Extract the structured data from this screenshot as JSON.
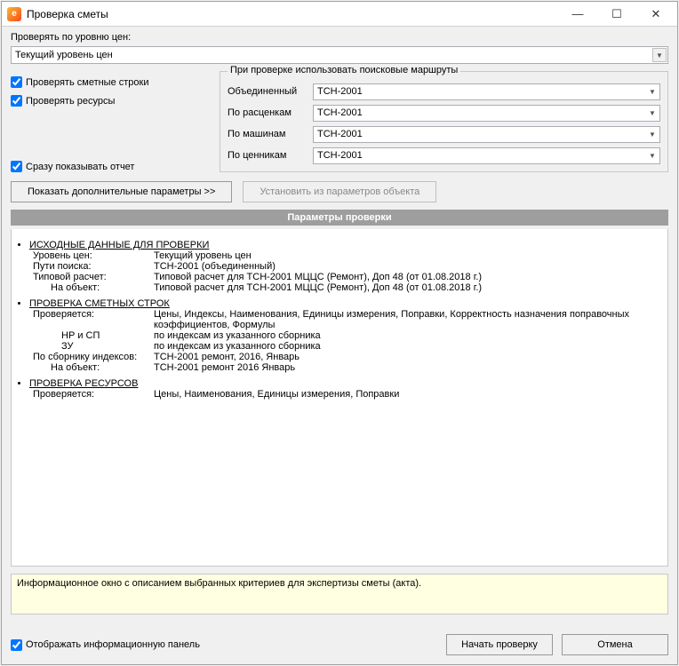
{
  "window": {
    "title": "Проверка сметы"
  },
  "level_label": "Проверять по уровню цен:",
  "level_value": "Текущий уровень цен",
  "checks": {
    "lines": "Проверять сметные строки",
    "resources": "Проверять ресурсы",
    "show_report": "Сразу показывать отчет"
  },
  "routes": {
    "group_label": "При проверке использовать поисковые маршруты",
    "rows": [
      {
        "label": "Объединенный",
        "value": "ТСН-2001"
      },
      {
        "label": "По расценкам",
        "value": "ТСН-2001"
      },
      {
        "label": "По машинам",
        "value": "ТСН-2001"
      },
      {
        "label": "По ценникам",
        "value": "ТСН-2001"
      }
    ]
  },
  "buttons": {
    "show_params": "Показать дополнительные параметры   >>",
    "set_from_object": "Установить из параметров объекта",
    "start": "Начать проверку",
    "cancel": "Отмена"
  },
  "params_header": "Параметры проверки",
  "sections": {
    "src": {
      "title": "ИСХОДНЫЕ ДАННЫЕ ДЛЯ ПРОВЕРКИ",
      "k1": "Уровень цен:",
      "v1": "Текущий уровень цен",
      "k2": "Пути поиска:",
      "v2": "ТСН-2001 (объединенный)",
      "k3": "Типовой расчет:",
      "v3": "Типовой расчет для ТСН-2001 МЦЦС (Ремонт), Доп 48 (от 01.08.2018 г.)",
      "k4": "На объект:",
      "v4": "Типовой расчет для ТСН-2001 МЦЦС (Ремонт), Доп 48 (от 01.08.2018 г.)"
    },
    "lines": {
      "title": "ПРОВЕРКА СМЕТНЫХ СТРОК",
      "k1": "Проверяется:",
      "v1": "Цены, Индексы, Наименования, Единицы измерения, Поправки, Корректность назначения поправочных коэффициентов, Формулы",
      "k2": "НР и СП",
      "v2": "по индексам из указанного сборника",
      "k3": "ЗУ",
      "v3": "по индексам из указанного сборника",
      "k4": "По сборнику индексов:",
      "v4": "ТСН-2001 ремонт, 2016, Январь",
      "k5": "На объект:",
      "v5": "ТСН-2001 ремонт 2016 Январь"
    },
    "res": {
      "title": "ПРОВЕРКА РЕСУРСОВ",
      "k1": "Проверяется:",
      "v1": "Цены, Наименования, Единицы измерения, Поправки"
    }
  },
  "info_text": "Информационное окно с описанием выбранных критериев для экспертизы сметы (акта).",
  "footer_check": "Отображать информационную панель"
}
